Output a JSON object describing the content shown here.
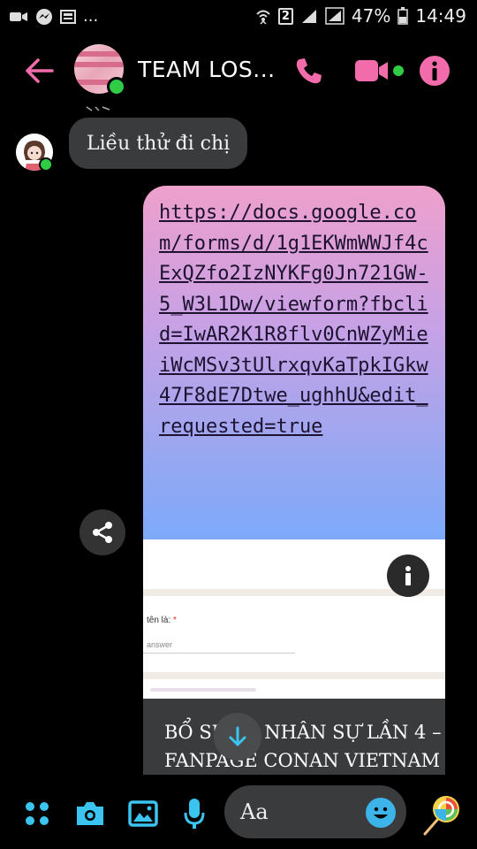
{
  "status_bar": {
    "ellipsis": "...",
    "sim_label": "2",
    "battery": "47%",
    "time": "14:49"
  },
  "header": {
    "title": "TEAM LOS...",
    "icons": [
      "back-arrow-icon",
      "phone-icon",
      "video-camera-icon",
      "info-icon"
    ],
    "accent": "#f26bab",
    "online_color": "#31cc46"
  },
  "messages": {
    "incoming_text": "Liều thử đi chị",
    "link_url": "https://docs.google.com/forms/d/1g1EKWmWWJf4cExQZfo2IzNYKFg0Jn721GW-5_W3L1Dw/viewform?fbclid=IwAR2K1R8flv0CnWZyMieiWcMSv3tUlrxqvKaTpkIGkw47F8dE7Dtwe_ughhU&edit_requested=true",
    "preview": {
      "field_label": "tên là:",
      "required_mark": "*",
      "answer_placeholder": "answer"
    },
    "link_title": "BỔ SUNG NHÂN SỰ LẦN 4 – FANPAGE CONAN VIETNAM"
  },
  "composer": {
    "placeholder": "Aa",
    "icons": [
      "menu-dots-icon",
      "camera-icon",
      "gallery-icon",
      "microphone-icon",
      "emoji-icon",
      "lollipop-icon"
    ]
  }
}
